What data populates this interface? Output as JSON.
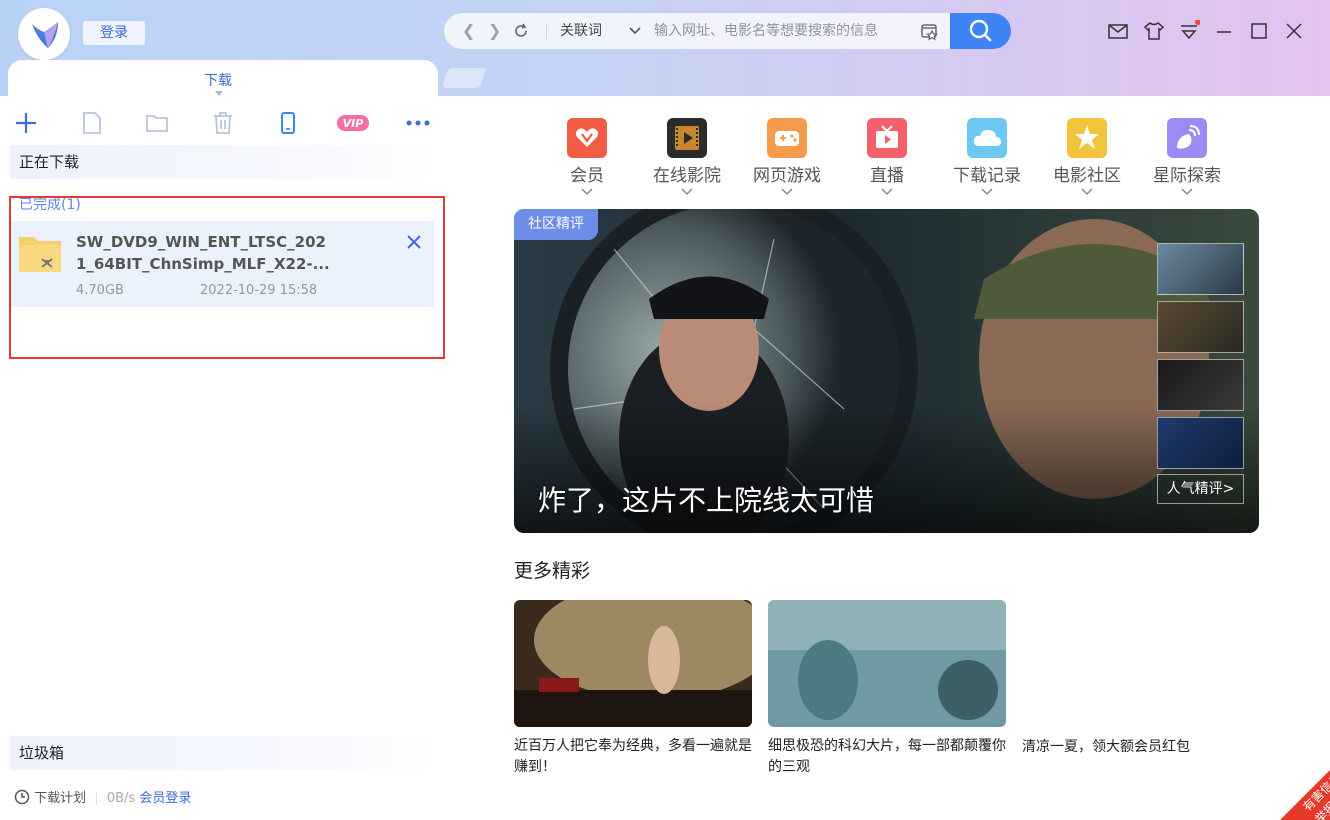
{
  "header": {
    "login_label": "登录",
    "address_keyword": "关联词",
    "address_placeholder": "输入网址、电影名等想要搜索的信息"
  },
  "tabs": {
    "download_tab": "下载"
  },
  "left": {
    "downloading_label": "正在下载",
    "completed_label": "已完成(1)",
    "trash_label": "垃圾箱",
    "vip_badge": "VIP",
    "item": {
      "name": "SW_DVD9_WIN_ENT_LTSC_2021_64BIT_ChnSimp_MLF_X22-...",
      "name_line1": "SW_DVD9_WIN_ENT_LTSC_202",
      "name_line2": "1_64BIT_ChnSimp_MLF_X22-...",
      "size": "4.70GB",
      "date": "2022-10-29 15:58"
    },
    "footer": {
      "plan": "下载计划",
      "speed": "0B/s",
      "member_login": "会员登录"
    }
  },
  "categories": [
    {
      "label": "会员",
      "color": "#f25c44"
    },
    {
      "label": "在线影院",
      "color": "#2b2b2b"
    },
    {
      "label": "网页游戏",
      "color": "#f59b4c"
    },
    {
      "label": "直播",
      "color": "#f2606b"
    },
    {
      "label": "下载记录",
      "color": "#6cc7f2"
    },
    {
      "label": "电影社区",
      "color": "#f2c43c"
    },
    {
      "label": "星际探索",
      "color": "#9b8bf2"
    }
  ],
  "hero": {
    "tag": "社区精评",
    "title": "炸了，这片不上院线太可惜",
    "more_link": "人气精评>"
  },
  "more": {
    "title": "更多精彩",
    "cards": [
      {
        "text": "近百万人把它奉为经典，多看一遍就是赚到！"
      },
      {
        "text": "细思极恐的科幻大片，每一部都颠覆你的三观"
      },
      {
        "text": "清凉一夏，领大额会员红包"
      }
    ]
  },
  "corner": {
    "line1": "有害信息",
    "line2": "举报"
  }
}
